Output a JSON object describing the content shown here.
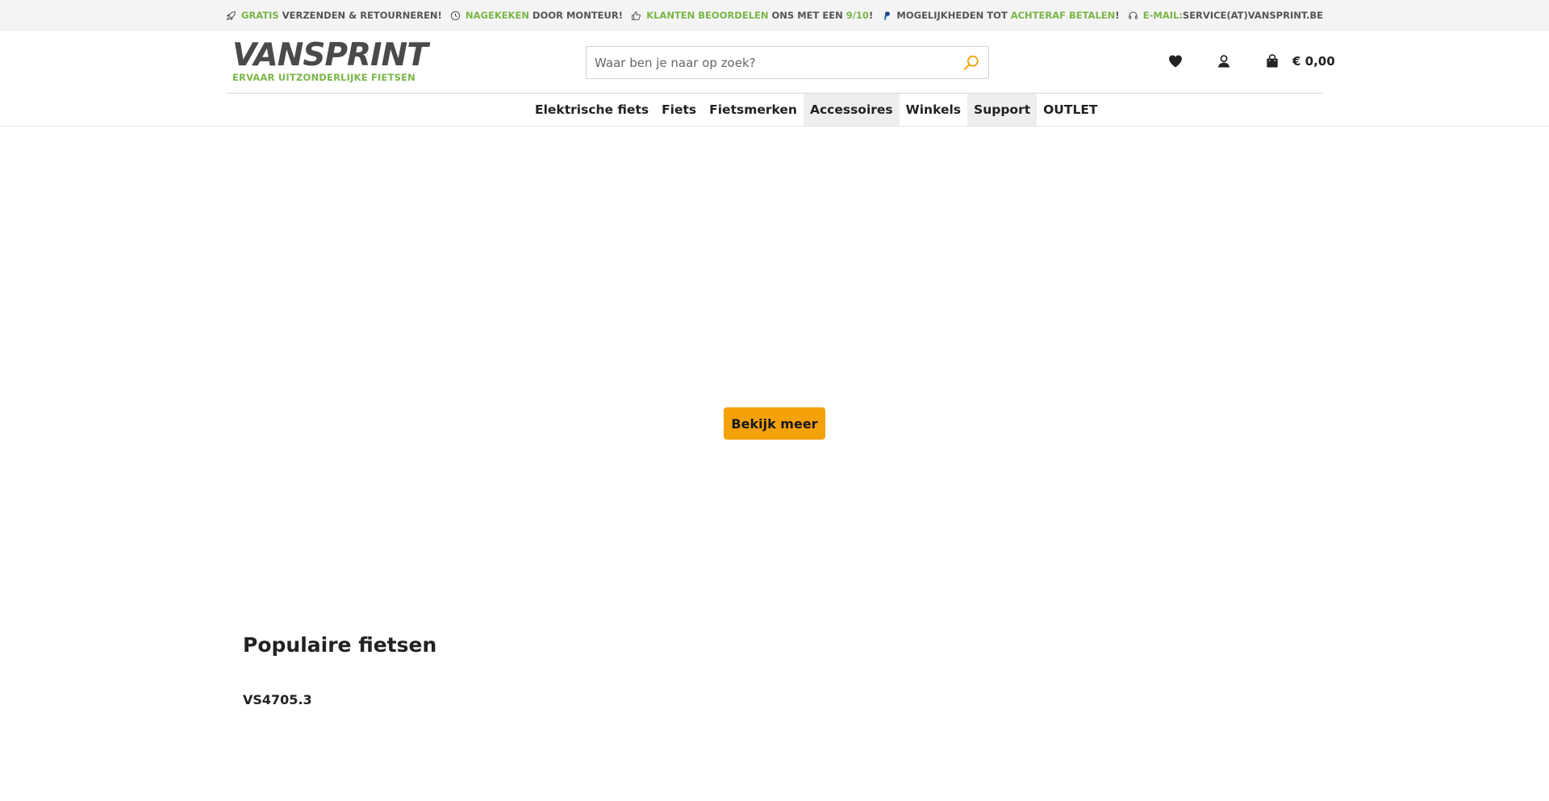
{
  "usp": [
    {
      "highlight": "Gratis",
      "rest": " verzenden & retourneren!",
      "icon": "rocket-icon"
    },
    {
      "highlight": "Nagekeken",
      "rest": " door monteur!",
      "icon": "clock-icon"
    },
    {
      "highlight": "Klanten beoordelen",
      "rest": " ons met een ",
      "score": "9/10",
      "tail": "!",
      "icon": "thumbs-up-icon"
    },
    {
      "prefix": "Mogelijkheden tot ",
      "highlight": "achteraf betalen",
      "tail": "!",
      "icon": "paypal-icon"
    },
    {
      "highlight": "E-mail:",
      "rest": "service(at)vansprint.be",
      "icon": "headset-icon"
    }
  ],
  "logo": {
    "name": "VANSPRINT",
    "tagline": "ERVAAR UITZONDERLIJKE FIETSEN"
  },
  "search": {
    "placeholder": "Waar ben je naar op zoek?"
  },
  "cart": {
    "total": "€ 0,00"
  },
  "nav": [
    {
      "label": "Elektrische fiets",
      "shaded": false
    },
    {
      "label": "Fiets",
      "shaded": false
    },
    {
      "label": "Fietsmerken",
      "shaded": false
    },
    {
      "label": "Accessoires",
      "shaded": true
    },
    {
      "label": "Winkels",
      "shaded": false
    },
    {
      "label": "Support",
      "shaded": true
    },
    {
      "label": "OUTLET",
      "shaded": false
    }
  ],
  "hero": {
    "button_label": "Bekijk meer"
  },
  "popular": {
    "title": "Populaire fietsen",
    "first_product": "VS4705.3"
  },
  "colors": {
    "accent_green": "#7ab648",
    "accent_orange": "#f5a10a",
    "icon_dark": "#222222"
  }
}
